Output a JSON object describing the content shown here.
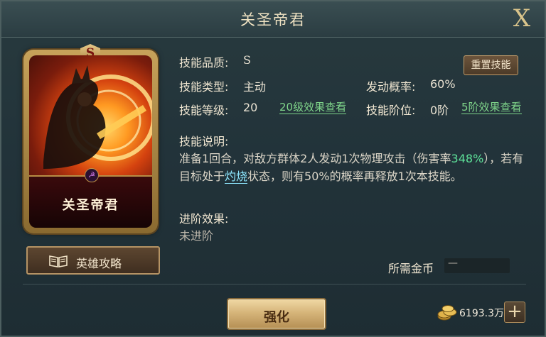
{
  "window": {
    "title": "关圣帝君",
    "close_label": "X"
  },
  "hero_card": {
    "name": "关圣帝君",
    "grade": "S"
  },
  "guide_button": {
    "label": "英雄攻略",
    "icon": "book-icon"
  },
  "skill": {
    "quality_label": "技能品质:",
    "quality_value": "S",
    "type_label": "技能类型:",
    "type_value": "主动",
    "trigger_label": "发动概率:",
    "trigger_value": "60%",
    "level_label": "技能等级:",
    "level_value": "20",
    "level_link": "20级效果查看",
    "rank_label": "技能阶位:",
    "rank_value": "0阶",
    "rank_link": "5阶效果查看",
    "reset_button": "重置技能",
    "desc_label": "技能说明:",
    "desc_part1": "准备1回合，对敌方群体2人发动1次物理攻击（伤害率",
    "desc_percent": "348%",
    "desc_part2": "），若有目标处于",
    "desc_status": "灼烧",
    "desc_part3": "状态，则有50%的概率再释放1次本技能。",
    "advance_label": "进阶效果:",
    "advance_value": "未进阶"
  },
  "cost": {
    "label": "所需金币",
    "value": "—"
  },
  "footer": {
    "enhance_button": "强化",
    "coins": "6193.3万",
    "plus_label": "+"
  },
  "colors": {
    "highlight_green": "#5ee39a",
    "status_cyan": "#8fe8ff",
    "gold_text": "#efe2c2"
  }
}
